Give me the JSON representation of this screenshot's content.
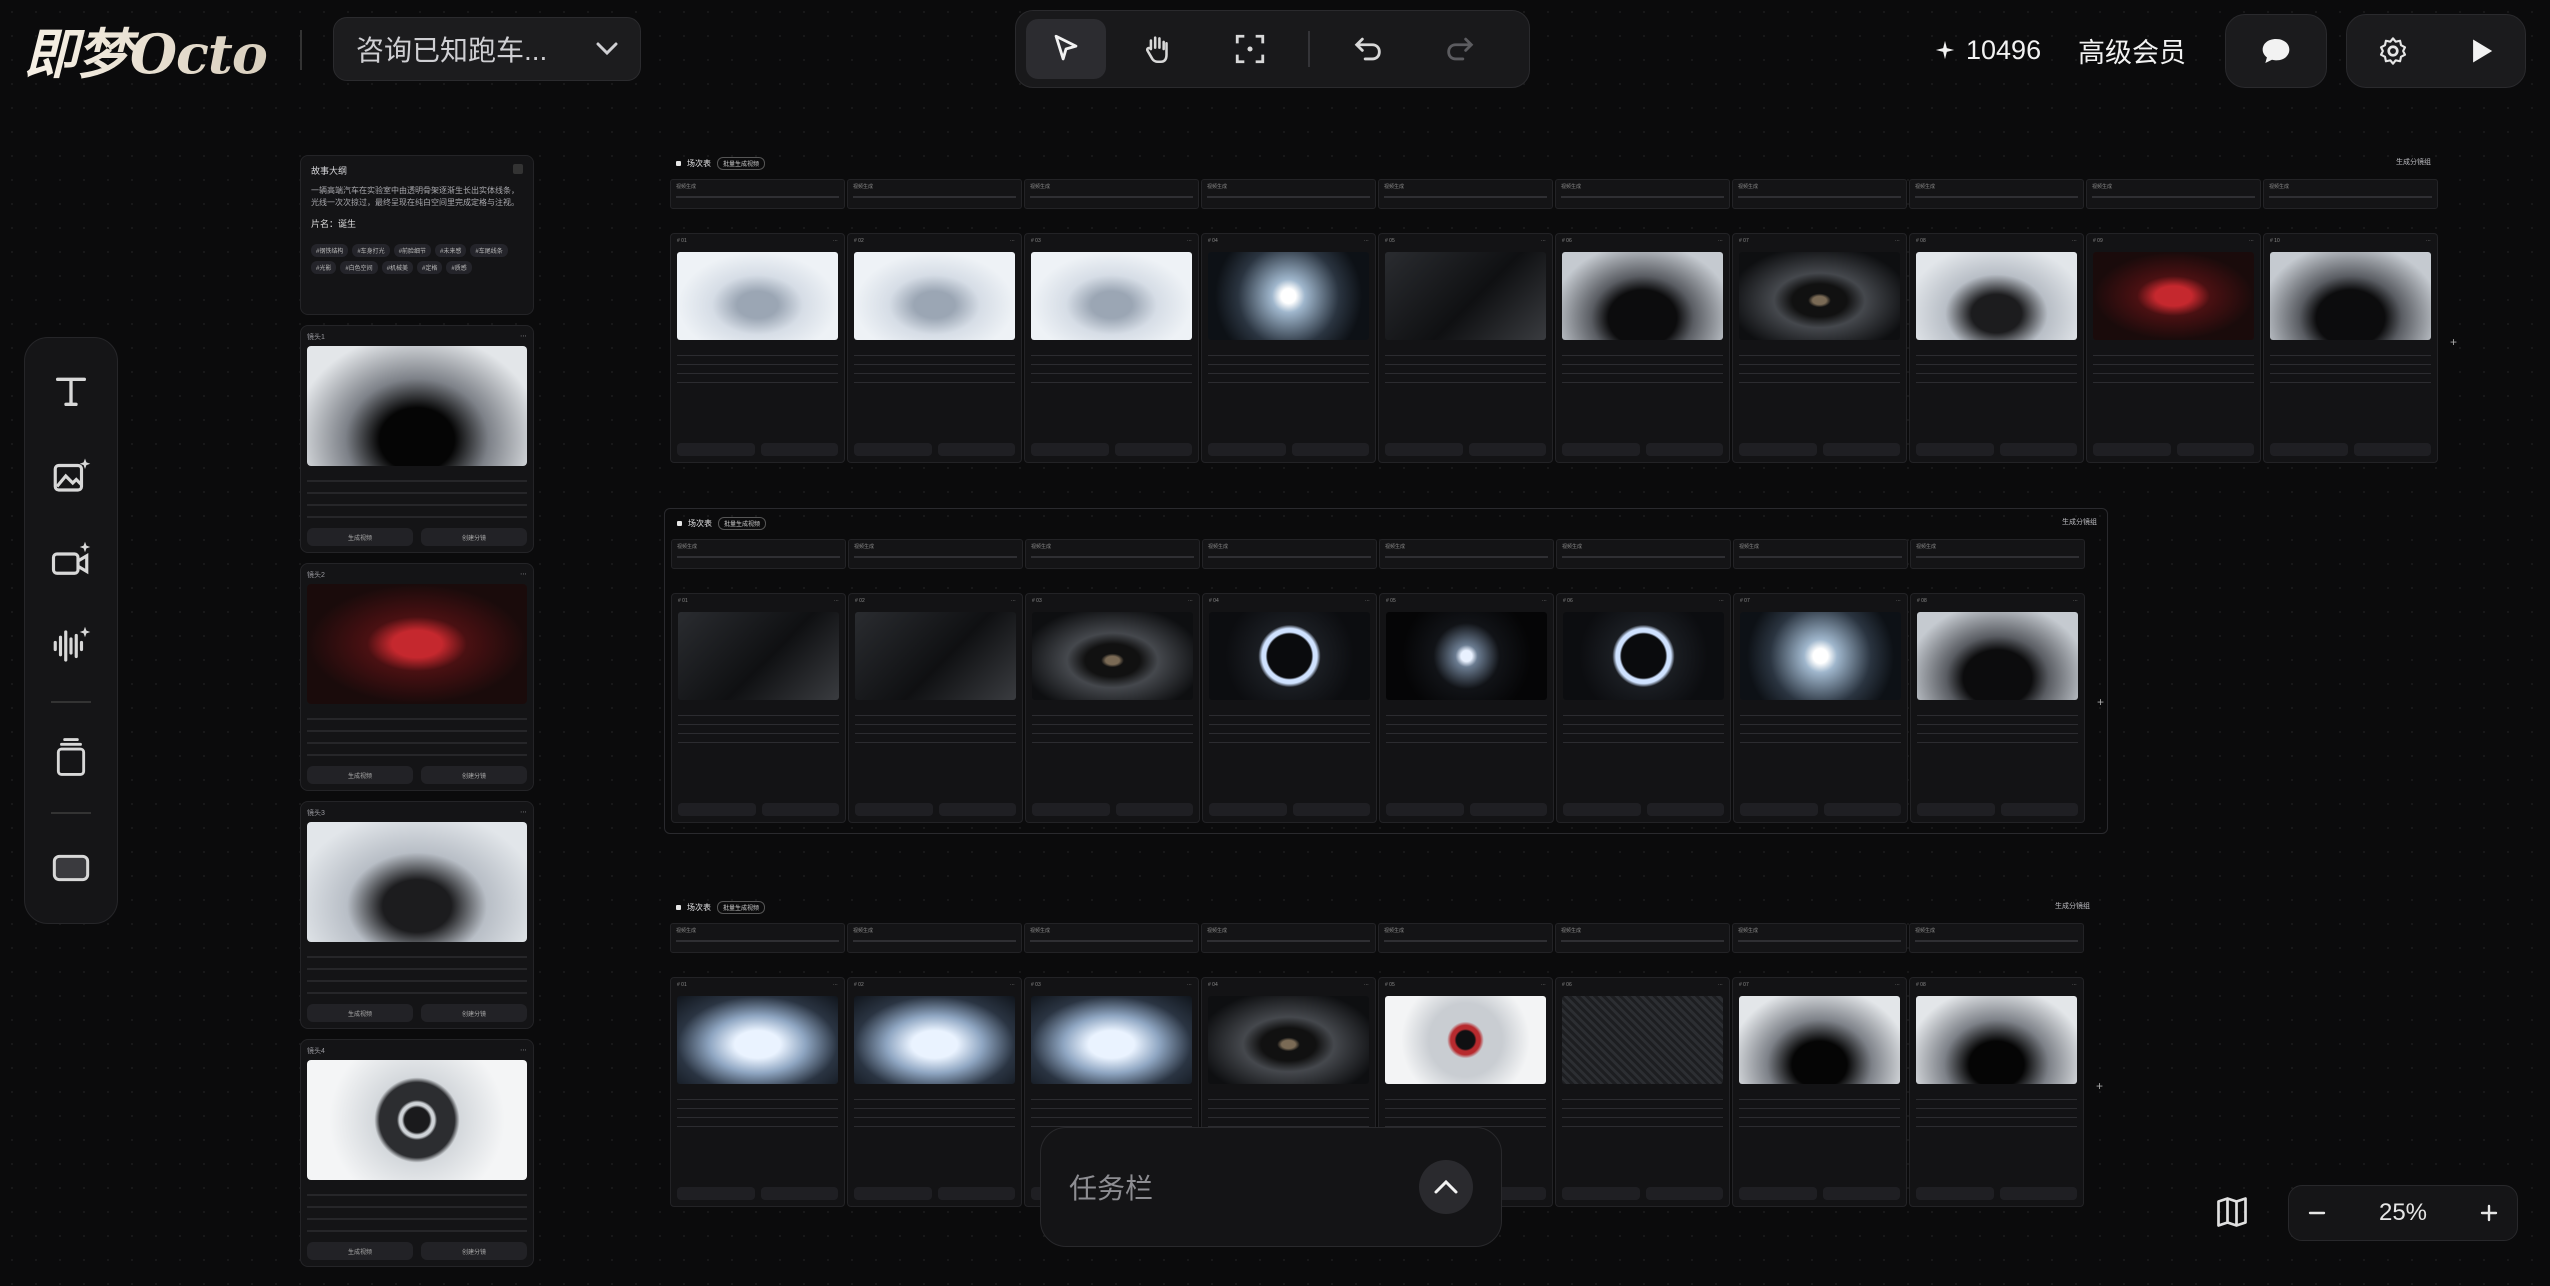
{
  "app": {
    "logo": "即梦Octo"
  },
  "project": {
    "name": "咨询已知跑车..."
  },
  "toolbar": {
    "tools": [
      "select",
      "hand",
      "frame",
      "undo",
      "redo"
    ]
  },
  "header": {
    "credits": "10496",
    "member": "高级会员"
  },
  "story": {
    "heading": "故事大纲",
    "summary": "一辆高端汽车在实验室中由透明骨架逐渐生长出实体线条，光线一次次掠过，最终呈现在纯白空间里完成定格与注视。",
    "title": "片名：诞生",
    "tags": [
      "#钢铁结构",
      "#车身打光",
      "#前脸细节",
      "#未来感",
      "#车尾线条",
      "#光影",
      "#白色空间",
      "#机械美",
      "#定格",
      "#质感"
    ],
    "shots": [
      {
        "label": "镜头1",
        "img": "t-studio",
        "btn1": "生成视频",
        "btn2": "创建分镜"
      },
      {
        "label": "镜头2",
        "img": "t-red",
        "btn1": "生成视频",
        "btn2": "创建分镜"
      },
      {
        "label": "镜头3",
        "img": "t-gray",
        "btn1": "生成视频",
        "btn2": "创建分镜"
      },
      {
        "label": "镜头4",
        "img": "t-wheel",
        "btn1": "生成视频",
        "btn2": "创建分镜"
      }
    ]
  },
  "sections": [
    {
      "title": "场次表",
      "chip": "批量生成视频",
      "gen": "生成分镜组",
      "cards": [
        {
          "no": "# 01",
          "img": "t-chassis"
        },
        {
          "no": "# 02",
          "img": "t-chassis"
        },
        {
          "no": "# 03",
          "img": "t-chassis"
        },
        {
          "no": "# 04",
          "img": "t-headlight"
        },
        {
          "no": "# 05",
          "img": "t-dark"
        },
        {
          "no": "# 06",
          "img": "t-front"
        },
        {
          "no": "# 07",
          "img": "t-grille"
        },
        {
          "no": "# 08",
          "img": "t-gray"
        },
        {
          "no": "# 09",
          "img": "t-red"
        },
        {
          "no": "# 10",
          "img": "t-front"
        }
      ]
    },
    {
      "title": "场次表",
      "chip": "批量生成视频",
      "gen": "生成分镜组",
      "cards": [
        {
          "no": "# 01",
          "img": "t-dark"
        },
        {
          "no": "# 02",
          "img": "t-dark"
        },
        {
          "no": "# 03",
          "img": "t-grille"
        },
        {
          "no": "# 04",
          "img": "t-ring"
        },
        {
          "no": "# 05",
          "img": "t-gauge"
        },
        {
          "no": "# 06",
          "img": "t-ring"
        },
        {
          "no": "# 07",
          "img": "t-headlight"
        },
        {
          "no": "# 08",
          "img": "t-front"
        }
      ]
    },
    {
      "title": "场次表",
      "chip": "批量生成视频",
      "gen": "生成分镜组",
      "cards": [
        {
          "no": "# 01",
          "img": "t-xray"
        },
        {
          "no": "# 02",
          "img": "t-xray"
        },
        {
          "no": "# 03",
          "img": "t-xray"
        },
        {
          "no": "# 04",
          "img": "t-grille"
        },
        {
          "no": "# 05",
          "img": "t-red-rim"
        },
        {
          "no": "# 06",
          "img": "t-carbon"
        },
        {
          "no": "# 07",
          "img": "t-studio"
        },
        {
          "no": "# 08",
          "img": "t-studio"
        }
      ]
    }
  ],
  "prompt_label": "视频生成",
  "taskbar": {
    "label": "任务栏"
  },
  "zoom": {
    "value": "25%"
  }
}
